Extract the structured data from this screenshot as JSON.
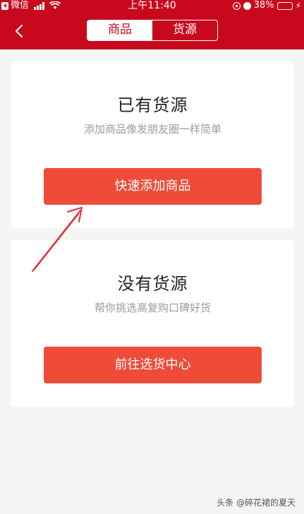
{
  "status_bar": {
    "carrier": "微信",
    "time": "上午11:40",
    "battery": "38%",
    "battery_level": 0.38,
    "icons": [
      "back-to-app-icon",
      "signal-icon",
      "wifi-icon",
      "lock-rotation-icon",
      "alarm-icon",
      "battery-icon",
      "charging-icon"
    ]
  },
  "header": {
    "back_icon": "chevron-left-icon",
    "tabs": [
      {
        "label": "商品",
        "active": true
      },
      {
        "label": "货源",
        "active": false
      }
    ],
    "background_color": "#c8091d"
  },
  "cards": [
    {
      "title": "已有货源",
      "subtitle": "添加商品像发朋友圈一样简单",
      "button": "快速添加商品"
    },
    {
      "title": "没有货源",
      "subtitle": "帮你挑选高复购口碑好货",
      "button": "前往选货中心"
    }
  ],
  "colors": {
    "button": "#ee4b38",
    "annotation_arrow": "#e0303a"
  },
  "annotation": {
    "icon": "annotation-arrow"
  },
  "watermark": "头条 @碎花裙的夏天"
}
